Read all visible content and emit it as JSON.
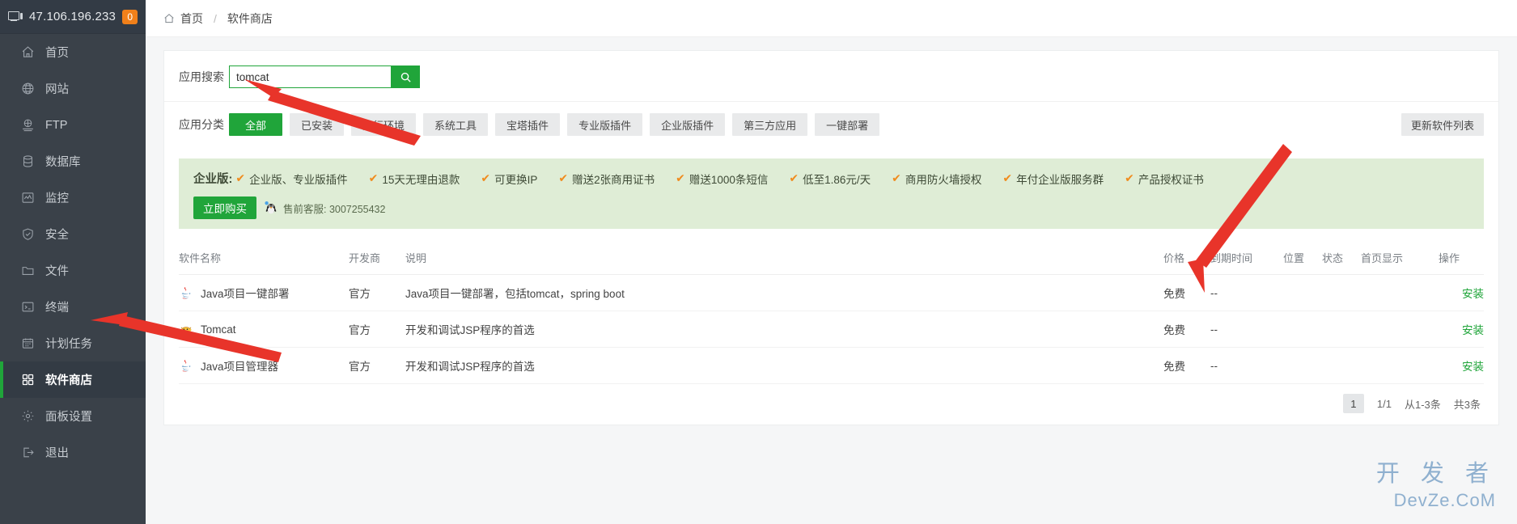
{
  "sidebar": {
    "header": {
      "ip": "47.106.196.233",
      "badge": "0",
      "icon": "monitor-icon"
    },
    "items": [
      {
        "label": "首页",
        "icon": "home-icon",
        "active": false
      },
      {
        "label": "网站",
        "icon": "globe-icon",
        "active": false
      },
      {
        "label": "FTP",
        "icon": "ftp-icon",
        "active": false
      },
      {
        "label": "数据库",
        "icon": "database-icon",
        "active": false
      },
      {
        "label": "监控",
        "icon": "monitor-chart-icon",
        "active": false
      },
      {
        "label": "安全",
        "icon": "shield-icon",
        "active": false
      },
      {
        "label": "文件",
        "icon": "folder-icon",
        "active": false
      },
      {
        "label": "终端",
        "icon": "terminal-icon",
        "active": false
      },
      {
        "label": "计划任务",
        "icon": "calendar-icon",
        "active": false
      },
      {
        "label": "软件商店",
        "icon": "grid-icon",
        "active": true
      },
      {
        "label": "面板设置",
        "icon": "gear-icon",
        "active": false
      },
      {
        "label": "退出",
        "icon": "logout-icon",
        "active": false
      }
    ]
  },
  "breadcrumb": {
    "home": "首页",
    "separator": "/",
    "current": "软件商店"
  },
  "search": {
    "label": "应用搜索",
    "value": "tomcat",
    "placeholder": "",
    "button_icon": "search-icon"
  },
  "categories": {
    "label": "应用分类",
    "items": [
      {
        "label": "全部",
        "active": true
      },
      {
        "label": "已安装",
        "active": false
      },
      {
        "label": "运行环境",
        "active": false
      },
      {
        "label": "系统工具",
        "active": false
      },
      {
        "label": "宝塔插件",
        "active": false
      },
      {
        "label": "专业版插件",
        "active": false
      },
      {
        "label": "企业版插件",
        "active": false
      },
      {
        "label": "第三方应用",
        "active": false
      },
      {
        "label": "一键部署",
        "active": false
      }
    ],
    "update_button": "更新软件列表"
  },
  "promo": {
    "title": "企业版:",
    "features": [
      "企业版、专业版插件",
      "15天无理由退款",
      "可更换IP",
      "赠送2张商用证书",
      "赠送1000条短信",
      "低至1.86元/天",
      "商用防火墙授权",
      "年付企业版服务群",
      "产品授权证书"
    ],
    "tick": "✔",
    "buy_button": "立即购买",
    "support_text": "售前客服: 3007255432",
    "bg_color": "#dfedd6",
    "accent_color": "#f08b1d"
  },
  "table": {
    "columns": [
      "软件名称",
      "开发商",
      "说明",
      "价格",
      "到期时间",
      "位置",
      "状态",
      "首页显示",
      "操作"
    ],
    "rows": [
      {
        "name": "Java项目一键部署",
        "icon": "java-icon",
        "developer": "官方",
        "description": "Java项目一键部署，包括tomcat，spring boot",
        "price": "免费",
        "expire": "--",
        "position": "",
        "status": "",
        "homepage": "",
        "action": "安装"
      },
      {
        "name": "Tomcat",
        "icon": "tomcat-icon",
        "developer": "官方",
        "description": "开发和调试JSP程序的首选",
        "price": "免费",
        "expire": "--",
        "position": "",
        "status": "",
        "homepage": "",
        "action": "安装"
      },
      {
        "name": "Java项目管理器",
        "icon": "java-icon",
        "developer": "官方",
        "description": "开发和调试JSP程序的首选",
        "price": "免费",
        "expire": "--",
        "position": "",
        "status": "",
        "homepage": "",
        "action": "安装"
      }
    ]
  },
  "pagination": {
    "current_page": "1",
    "page_of": "1/1",
    "range_text": "从1-3条",
    "total_text": "共3条"
  },
  "watermark": {
    "line1": "开 发 者",
    "line2": "DevZe.CoM",
    "color": "#8fb0cf"
  },
  "annotations": {
    "arrow_color": "#e8342a",
    "arrows": [
      {
        "name": "arrow-to-search-input"
      },
      {
        "name": "arrow-to-install-button"
      },
      {
        "name": "arrow-to-sidebar-software-store"
      }
    ]
  }
}
